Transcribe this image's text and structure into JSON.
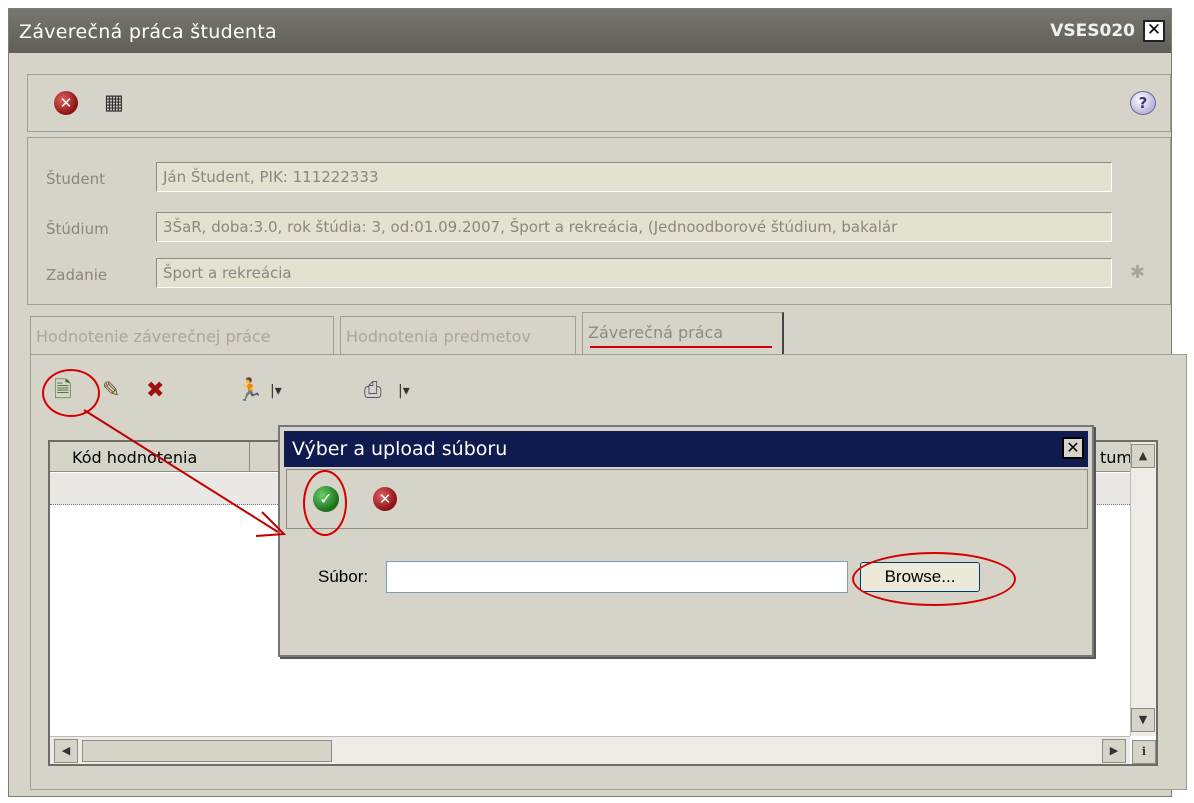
{
  "window": {
    "title": "Záverečná práca študenta",
    "code": "VSES020",
    "close_glyph": "✕"
  },
  "toolbar": {
    "icons": [
      "cancel-icon",
      "grid-edit-icon",
      "help-icon"
    ],
    "help_glyph": "?"
  },
  "fields": {
    "student": {
      "label": "Študent",
      "value": "Ján Študent, PIK: 111222333"
    },
    "study": {
      "label": "Štúdium",
      "value": "3ŠaR, doba:3.0, rok štúdia: 3, od:01.09.2007, Šport a rekreácia, (Jednoodborové štúdium, bakalár"
    },
    "assignment": {
      "label": "Zadanie",
      "value": "Šport a rekreácia"
    }
  },
  "tabs": [
    {
      "label": "Hodnotenie záverečnej práce",
      "active": false
    },
    {
      "label": "Hodnotenia predmetov",
      "active": false
    },
    {
      "label": "Záverečná práca",
      "active": true
    }
  ],
  "grid": {
    "columns": [
      "Kód hodnotenia",
      "tum"
    ],
    "scroll_up": "▲",
    "scroll_down": "▼",
    "scroll_left": "◀",
    "scroll_right": "▶",
    "info": "i"
  },
  "dialog": {
    "title": "Výber a upload súboru",
    "file_label": "Súbor:",
    "file_value": "",
    "browse_label": "Browse...",
    "close_glyph": "✕"
  },
  "colors": {
    "title_bar": "#666560",
    "dialog_title": "#0f1a4e",
    "annotation": "#d40000",
    "window_bg": "#d6d3c8"
  }
}
